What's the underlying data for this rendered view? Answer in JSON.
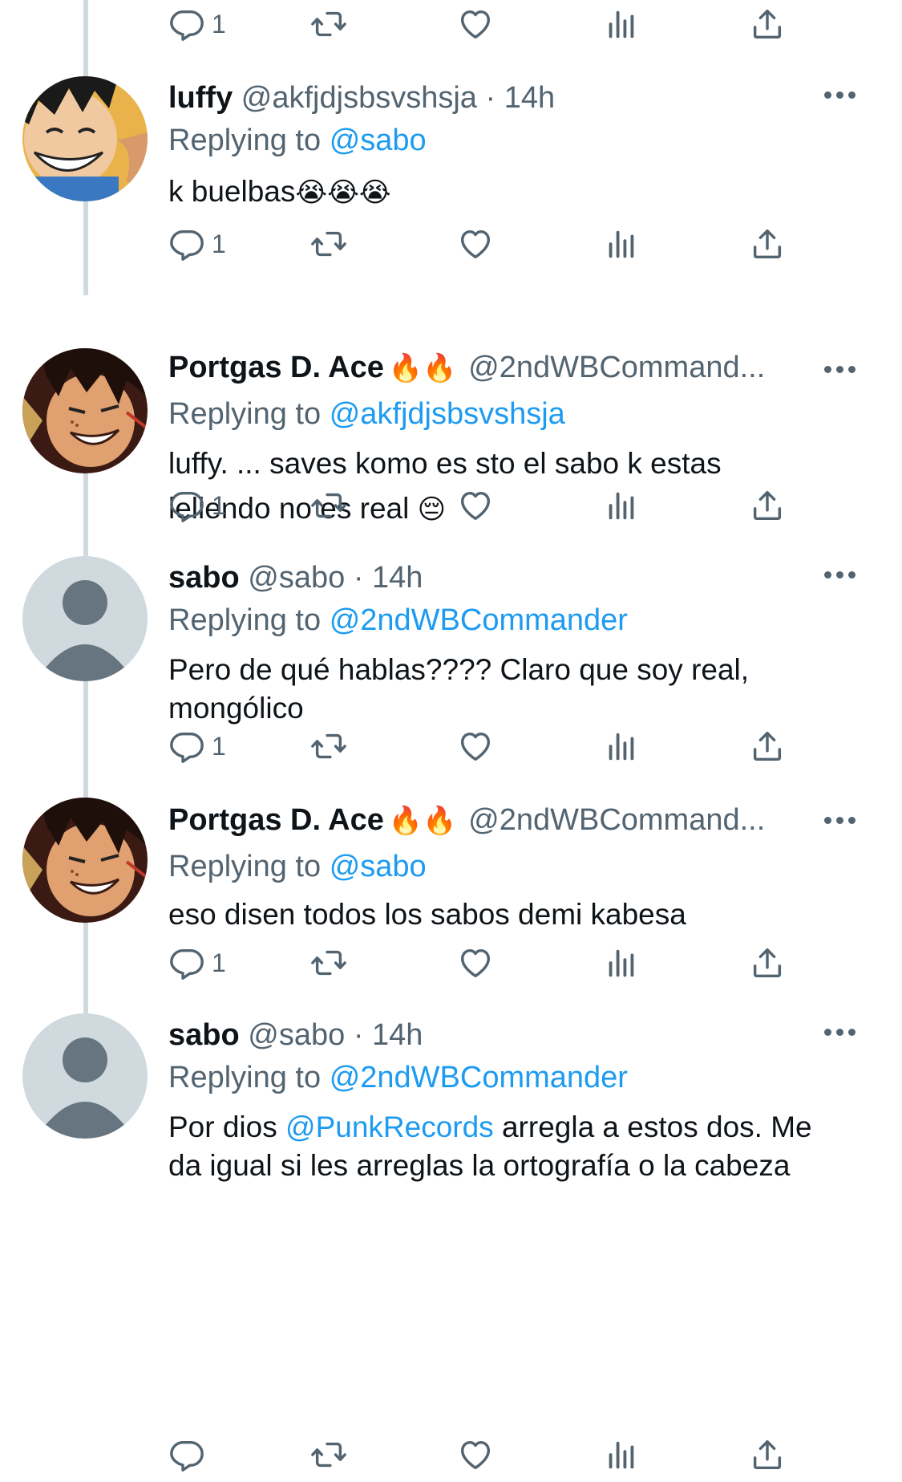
{
  "colors": {
    "text": "#0f1419",
    "secondary": "#536471",
    "accent": "#1d9bf0",
    "thread_line": "#cfd9de"
  },
  "top_actions": {
    "reply_count": "1"
  },
  "tweets": [
    {
      "name": "luffy",
      "handle": "@akfjdjsbsvshsja",
      "separator": "·",
      "time": "14h",
      "replying_label": "Replying to",
      "replying_to": "@sabo",
      "text": "k buelbas",
      "emojis": "😭😭😭",
      "reply_count": "1",
      "avatar": "luffy-avatar"
    },
    {
      "name": "Portgas D. Ace",
      "flames": "🔥🔥",
      "handle": "@2ndWBCommand...",
      "replying_label": "Replying to",
      "replying_to": "@akfjdjsbsvshsja",
      "text_line1": "luffy. ... saves komo es sto el sabo k estas",
      "text_line2": "lellendo no es real",
      "emoji": "😔",
      "reply_count": "1",
      "avatar": "ace-avatar"
    },
    {
      "name": "sabo",
      "handle": "@sabo",
      "separator": "·",
      "time": "14h",
      "replying_label": "Replying to",
      "replying_to": "@2ndWBCommander",
      "text": "Pero de qué hablas???? Claro que soy real, mongólico",
      "reply_count": "1",
      "avatar": "default-avatar"
    },
    {
      "name": "Portgas D. Ace",
      "flames": "🔥🔥",
      "handle": "@2ndWBCommand...",
      "replying_label": "Replying to",
      "replying_to": "@sabo",
      "text": "eso disen todos los sabos demi kabesa",
      "reply_count": "1",
      "avatar": "ace-avatar"
    },
    {
      "name": "sabo",
      "handle": "@sabo",
      "separator": "·",
      "time": "14h",
      "replying_label": "Replying to",
      "replying_to": "@2ndWBCommander",
      "text_before": "Por dios ",
      "mention": "@PunkRecords",
      "text_after": " arregla a estos dos. Me da igual si les arreglas la ortografía o la cabeza",
      "avatar": "default-avatar"
    }
  ]
}
